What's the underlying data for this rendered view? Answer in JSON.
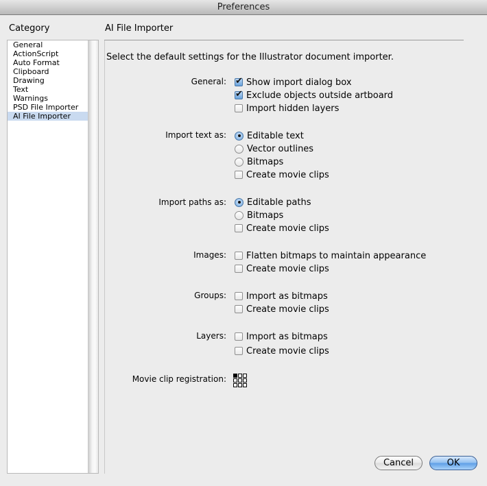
{
  "window": {
    "title": "Preferences"
  },
  "sidebar": {
    "heading": "Category",
    "items": [
      {
        "label": "General",
        "selected": false
      },
      {
        "label": "ActionScript",
        "selected": false
      },
      {
        "label": "Auto Format",
        "selected": false
      },
      {
        "label": "Clipboard",
        "selected": false
      },
      {
        "label": "Drawing",
        "selected": false
      },
      {
        "label": "Text",
        "selected": false
      },
      {
        "label": "Warnings",
        "selected": false
      },
      {
        "label": "PSD File Importer",
        "selected": false
      },
      {
        "label": "AI File Importer",
        "selected": true
      }
    ]
  },
  "panel": {
    "title": "AI File Importer",
    "intro": "Select the default settings for the Illustrator document importer.",
    "sections": {
      "general": {
        "label": "General:",
        "options": [
          {
            "label": "Show import dialog box",
            "type": "checkbox",
            "checked": true
          },
          {
            "label": "Exclude objects outside artboard",
            "type": "checkbox",
            "checked": true
          },
          {
            "label": "Import hidden layers",
            "type": "checkbox",
            "checked": false
          }
        ]
      },
      "text": {
        "label": "Import text as:",
        "options": [
          {
            "label": "Editable text",
            "type": "radio",
            "checked": true
          },
          {
            "label": "Vector outlines",
            "type": "radio",
            "checked": false
          },
          {
            "label": "Bitmaps",
            "type": "radio",
            "checked": false
          },
          {
            "label": "Create movie clips",
            "type": "checkbox",
            "checked": false
          }
        ]
      },
      "paths": {
        "label": "Import paths as:",
        "options": [
          {
            "label": "Editable paths",
            "type": "radio",
            "checked": true
          },
          {
            "label": "Bitmaps",
            "type": "radio",
            "checked": false
          },
          {
            "label": "Create movie clips",
            "type": "checkbox",
            "checked": false
          }
        ]
      },
      "images": {
        "label": "Images:",
        "options": [
          {
            "label": "Flatten bitmaps to maintain appearance",
            "type": "checkbox",
            "checked": false
          },
          {
            "label": "Create movie clips",
            "type": "checkbox",
            "checked": false
          }
        ]
      },
      "groups": {
        "label": "Groups:",
        "options": [
          {
            "label": "Import as bitmaps",
            "type": "checkbox",
            "checked": false
          },
          {
            "label": "Create movie clips",
            "type": "checkbox",
            "checked": false
          }
        ]
      },
      "layers": {
        "label": "Layers:",
        "options": [
          {
            "label": "Import as bitmaps",
            "type": "checkbox",
            "checked": false
          },
          {
            "label": "Create movie clips",
            "type": "checkbox",
            "checked": false
          }
        ]
      }
    },
    "registration": {
      "label": "Movie clip registration:",
      "selected_point": "top-left"
    }
  },
  "buttons": {
    "cancel": "Cancel",
    "ok": "OK"
  }
}
